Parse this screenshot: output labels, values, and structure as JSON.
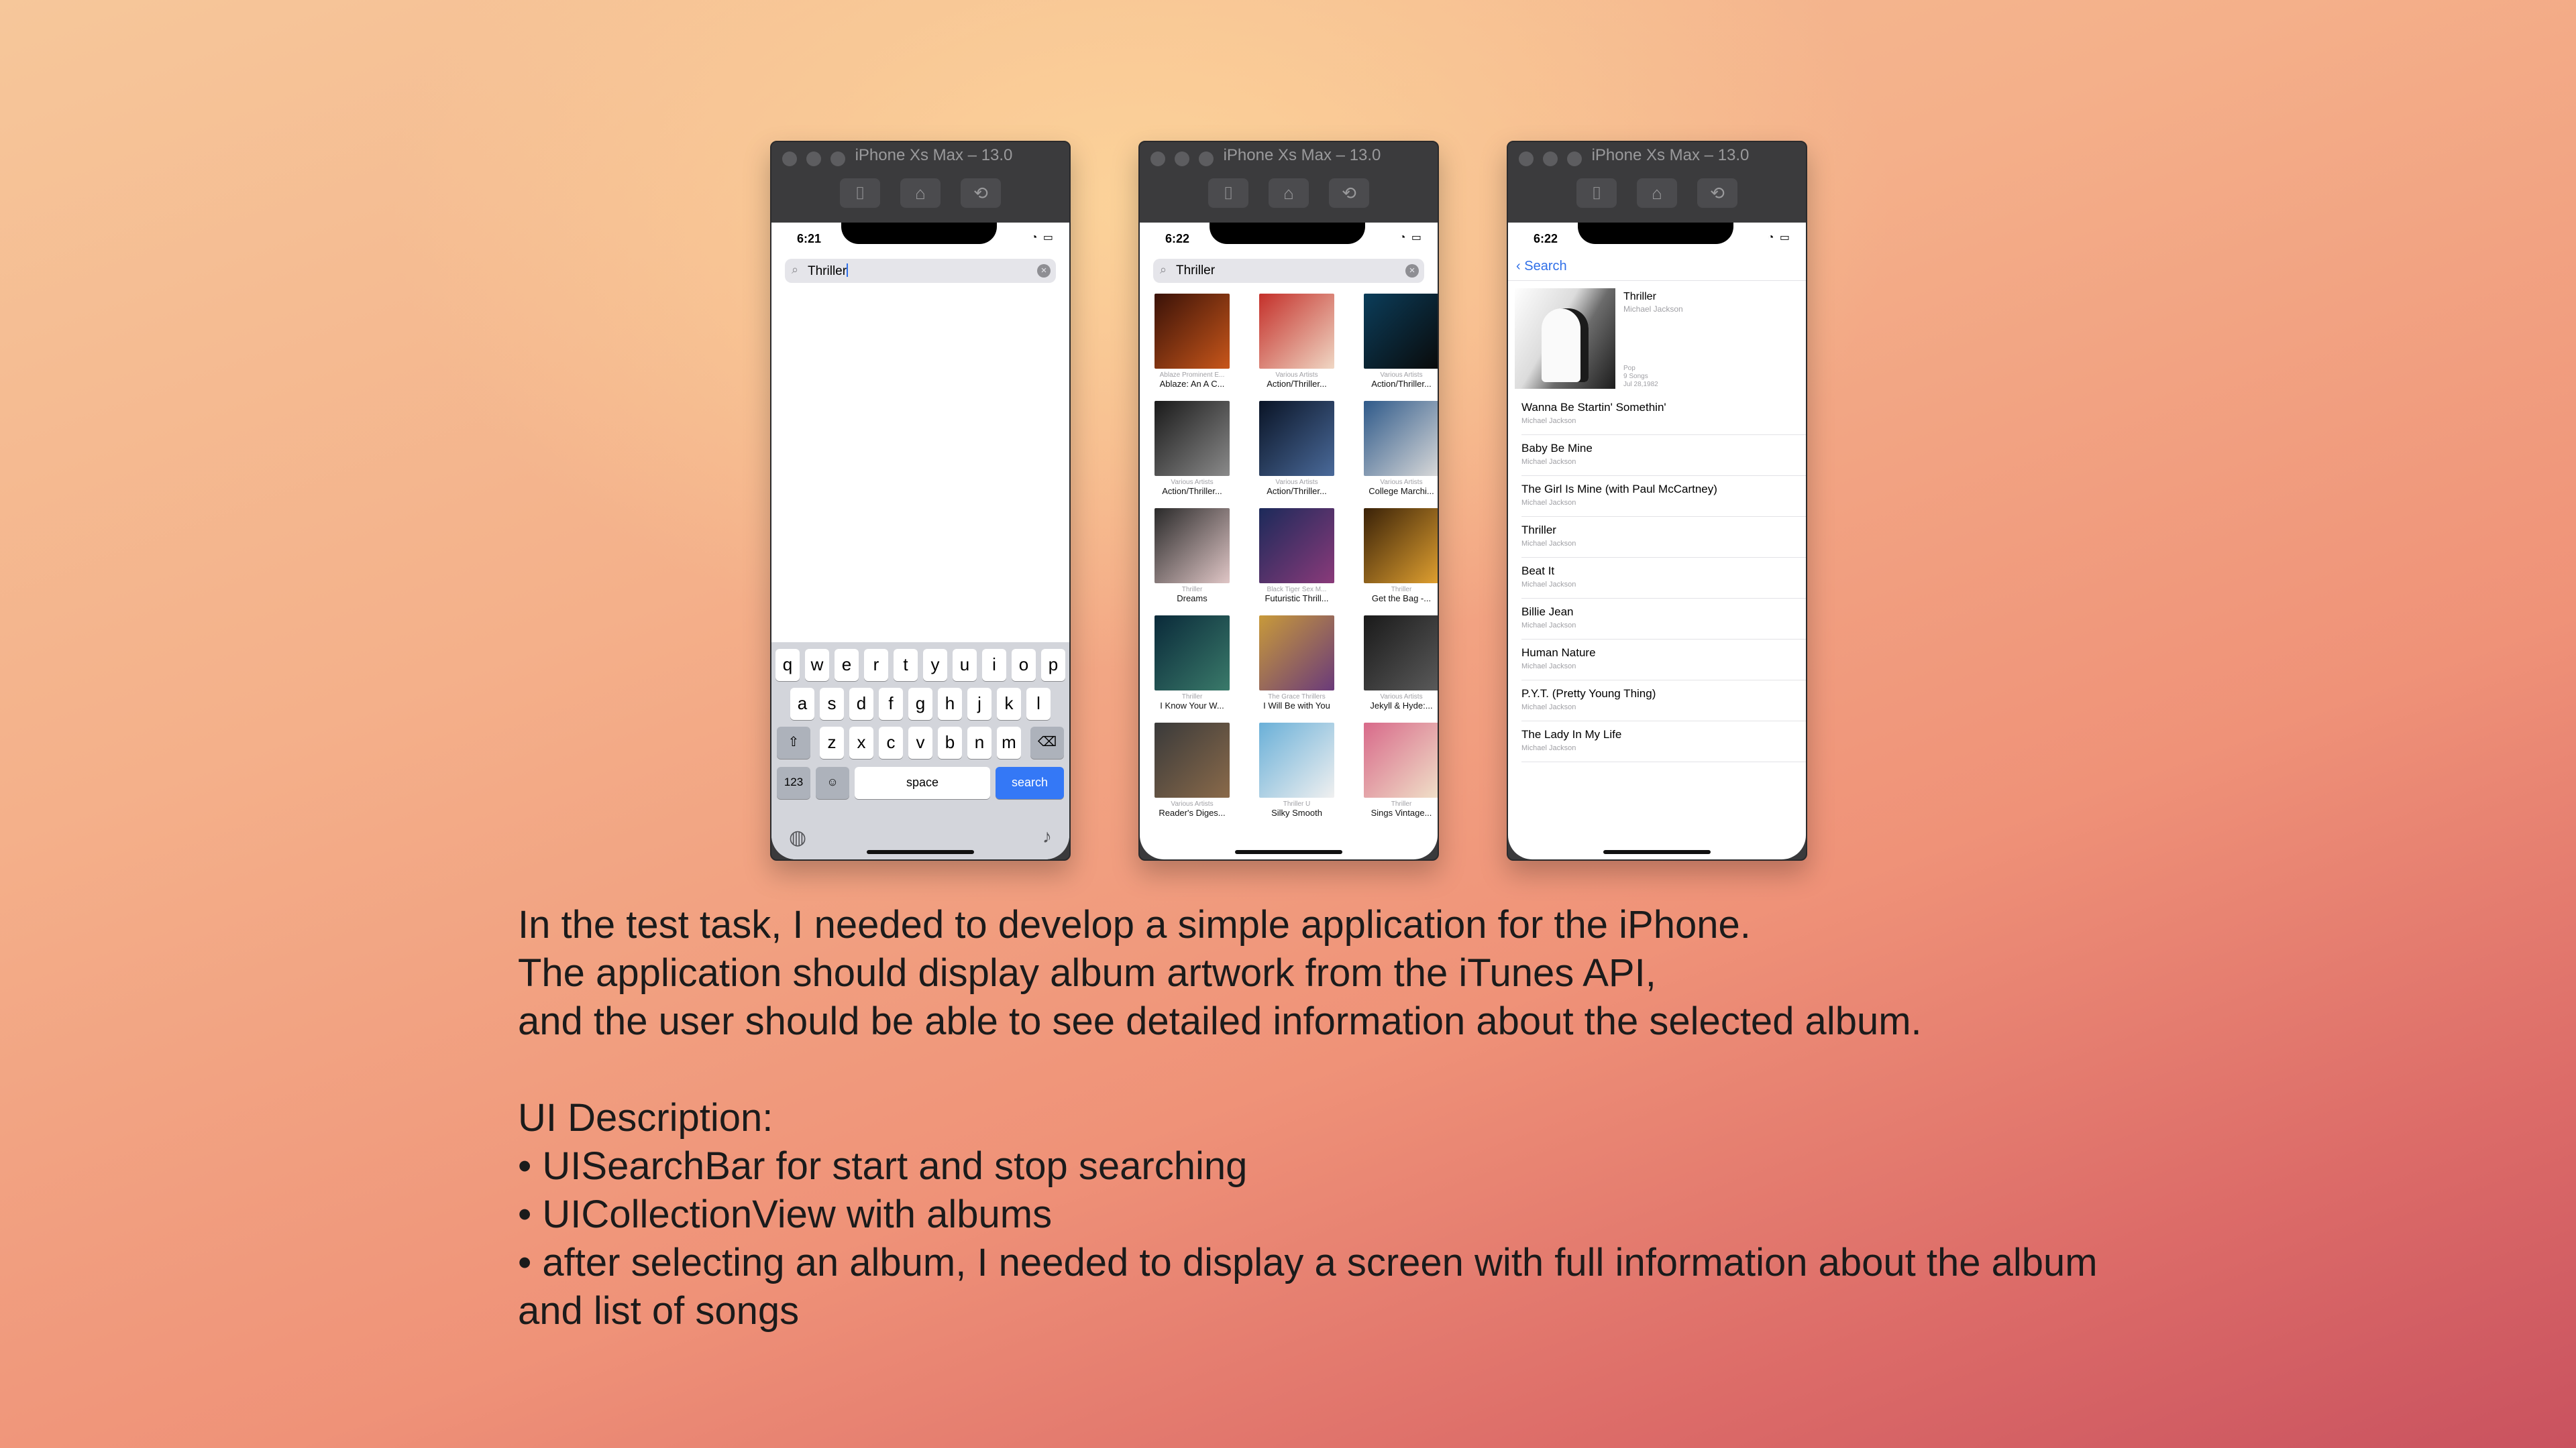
{
  "simulator_title": "iPhone Xs Max – 13.0",
  "screen1": {
    "time": "6:21",
    "search_text": "Thriller",
    "keyboard": {
      "row1": [
        "q",
        "w",
        "e",
        "r",
        "t",
        "y",
        "u",
        "i",
        "o",
        "p"
      ],
      "row2": [
        "a",
        "s",
        "d",
        "f",
        "g",
        "h",
        "j",
        "k",
        "l"
      ],
      "row3": [
        "z",
        "x",
        "c",
        "v",
        "b",
        "n",
        "m"
      ],
      "num_label": "123",
      "space_label": "space",
      "search_label": "search"
    }
  },
  "screen2": {
    "time": "6:22",
    "search_text": "Thriller",
    "albums": [
      {
        "artist": "Ablaze Prominent E...",
        "title": "Ablaze: An A C...",
        "colors": [
          "#3a1208",
          "#c8561a"
        ]
      },
      {
        "artist": "Various Artists",
        "title": "Action/Thriller...",
        "colors": [
          "#c4302a",
          "#f0d7c4"
        ]
      },
      {
        "artist": "Various Artists",
        "title": "Action/Thriller...",
        "colors": [
          "#0b3d5a",
          "#0a0a0a"
        ]
      },
      {
        "artist": "Various Artists",
        "title": "Action/Thriller...",
        "colors": [
          "#1a1a1a",
          "#8a8a8a"
        ]
      },
      {
        "artist": "Various Artists",
        "title": "Action/Thriller...",
        "colors": [
          "#0a1426",
          "#4a6a9a"
        ]
      },
      {
        "artist": "Various Artists",
        "title": "College Marchi...",
        "colors": [
          "#2f5a8a",
          "#d9d9d9"
        ]
      },
      {
        "artist": "Thriller",
        "title": "Dreams",
        "colors": [
          "#2a2a2a",
          "#e0c6c6"
        ]
      },
      {
        "artist": "Black Tiger Sex M...",
        "title": "Futuristic Thrill...",
        "colors": [
          "#1c2a5a",
          "#8a3a7a"
        ]
      },
      {
        "artist": "Thriller",
        "title": "Get the Bag -...",
        "colors": [
          "#3a2208",
          "#e0a030"
        ]
      },
      {
        "artist": "Thriller",
        "title": "I Know Your W...",
        "colors": [
          "#0a2a3a",
          "#3a7a6a"
        ]
      },
      {
        "artist": "The Grace Thrillers",
        "title": "I Will Be with You",
        "colors": [
          "#c89a3a",
          "#6a3a7a"
        ]
      },
      {
        "artist": "Various Artists",
        "title": "Jekyll & Hyde:...",
        "colors": [
          "#1a1a1a",
          "#5a5a5a"
        ]
      },
      {
        "artist": "Various Artists",
        "title": "Reader's Diges...",
        "colors": [
          "#3a3a3a",
          "#8a6a4a"
        ]
      },
      {
        "artist": "Thriller U",
        "title": "Silky Smooth",
        "colors": [
          "#6ab0d8",
          "#f0f0f0"
        ]
      },
      {
        "artist": "Thriller",
        "title": "Sings Vintage...",
        "colors": [
          "#d86a8a",
          "#f0e0c8"
        ]
      }
    ]
  },
  "screen3": {
    "time": "6:22",
    "back_label": "Search",
    "album_title": "Thriller",
    "album_artist": "Michael Jackson",
    "album_meta": [
      "Pop",
      "9 Songs",
      "Jul 28,1982"
    ],
    "songs": [
      {
        "title": "Wanna Be Startin' Somethin'",
        "artist": "Michael Jackson"
      },
      {
        "title": "Baby Be Mine",
        "artist": "Michael Jackson"
      },
      {
        "title": "The Girl Is Mine (with Paul McCartney)",
        "artist": "Michael Jackson"
      },
      {
        "title": "Thriller",
        "artist": "Michael Jackson"
      },
      {
        "title": "Beat It",
        "artist": "Michael Jackson"
      },
      {
        "title": "Billie Jean",
        "artist": "Michael Jackson"
      },
      {
        "title": "Human Nature",
        "artist": "Michael Jackson"
      },
      {
        "title": "P.Y.T. (Pretty Young Thing)",
        "artist": "Michael Jackson"
      },
      {
        "title": "The Lady In My Life",
        "artist": "Michael Jackson"
      }
    ]
  },
  "description": {
    "intro": [
      "In the test task, I needed to develop a simple application for the iPhone.",
      "The application should display album artwork from the iTunes API,",
      "and the user should be able to see detailed information about the selected album."
    ],
    "ui_heading": "UI Description:",
    "bullets": [
      "• UISearchBar for start and stop searching",
      "• UICollectionView with albums",
      "• after selecting an album, I needed to display a screen with full information about the album and list of songs"
    ]
  }
}
